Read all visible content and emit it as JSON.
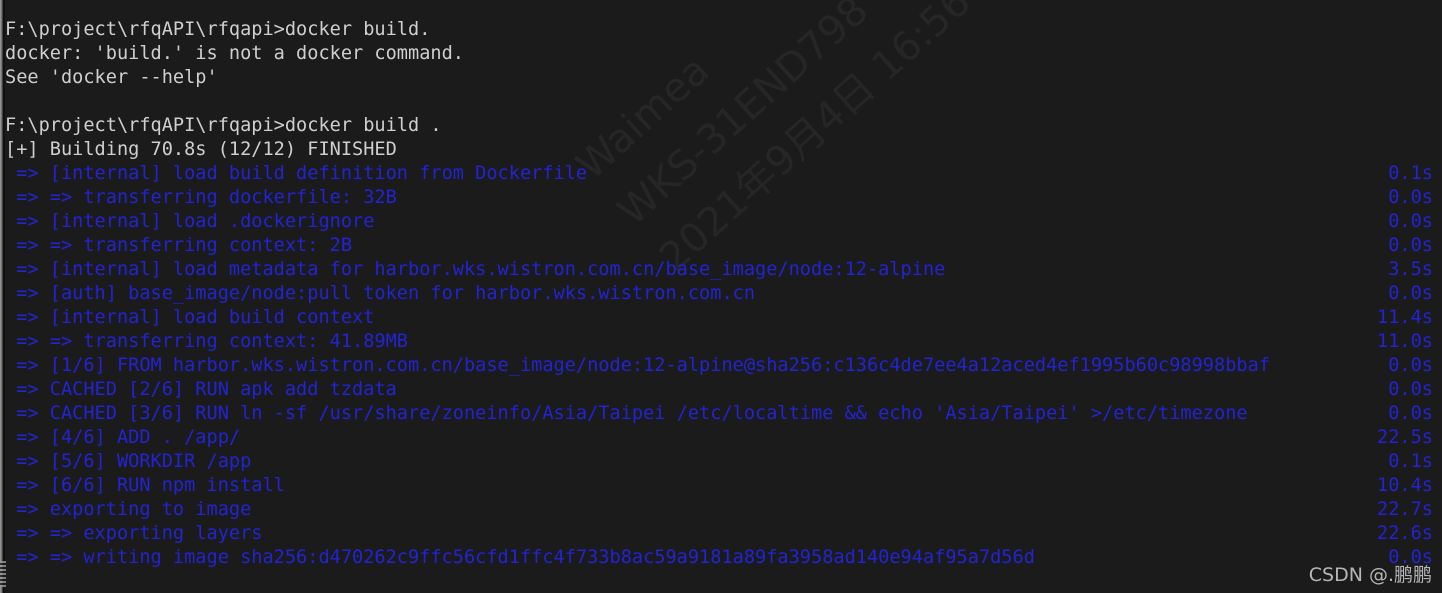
{
  "terminal": {
    "background_color": "#1b1b1b",
    "text_color": "#cfcfcf",
    "build_text_color": "#2323d4",
    "lines": [
      {
        "text": "F:\\project\\rfqAPI\\rfqapi>docker build.",
        "color": "light",
        "time": ""
      },
      {
        "text": "docker: 'build.' is not a docker command.",
        "color": "light",
        "time": ""
      },
      {
        "text": "See 'docker --help'",
        "color": "light",
        "time": ""
      },
      {
        "text": "",
        "color": "light",
        "time": ""
      },
      {
        "text": "F:\\project\\rfqAPI\\rfqapi>docker build .",
        "color": "light",
        "time": ""
      },
      {
        "text": "[+] Building 70.8s (12/12) FINISHED",
        "color": "light",
        "time": ""
      },
      {
        "text": " => [internal] load build definition from Dockerfile",
        "color": "blue",
        "time": "0.1s"
      },
      {
        "text": " => => transferring dockerfile: 32B",
        "color": "blue",
        "time": "0.0s"
      },
      {
        "text": " => [internal] load .dockerignore",
        "color": "blue",
        "time": "0.0s"
      },
      {
        "text": " => => transferring context: 2B",
        "color": "blue",
        "time": "0.0s"
      },
      {
        "text": " => [internal] load metadata for harbor.wks.wistron.com.cn/base_image/node:12-alpine",
        "color": "blue",
        "time": "3.5s"
      },
      {
        "text": " => [auth] base_image/node:pull token for harbor.wks.wistron.com.cn",
        "color": "blue",
        "time": "0.0s"
      },
      {
        "text": " => [internal] load build context",
        "color": "blue",
        "time": "11.4s"
      },
      {
        "text": " => => transferring context: 41.89MB",
        "color": "blue",
        "time": "11.0s"
      },
      {
        "text": " => [1/6] FROM harbor.wks.wistron.com.cn/base_image/node:12-alpine@sha256:c136c4de7ee4a12aced4ef1995b60c98998bbaf",
        "color": "blue",
        "time": "0.0s"
      },
      {
        "text": " => CACHED [2/6] RUN apk add tzdata",
        "color": "blue",
        "time": "0.0s"
      },
      {
        "text": " => CACHED [3/6] RUN ln -sf /usr/share/zoneinfo/Asia/Taipei /etc/localtime && echo 'Asia/Taipei' >/etc/timezone",
        "color": "blue",
        "time": "0.0s"
      },
      {
        "text": " => [4/6] ADD . /app/",
        "color": "blue",
        "time": "22.5s"
      },
      {
        "text": " => [5/6] WORKDIR /app",
        "color": "blue",
        "time": "0.1s"
      },
      {
        "text": " => [6/6] RUN npm install",
        "color": "blue",
        "time": "10.4s"
      },
      {
        "text": " => exporting to image",
        "color": "blue",
        "time": "22.7s"
      },
      {
        "text": " => => exporting layers",
        "color": "blue",
        "time": "22.6s"
      },
      {
        "text": " => => writing image sha256:d470262c9ffc56cfd1ffc4f733b8ac59a9181a89fa3958ad140e94af95a7d56d",
        "color": "blue",
        "time": "0.0s"
      }
    ]
  },
  "watermark": {
    "lines": [
      "Waimea",
      "WKS-31END798",
      "2021年9月4日 16:56"
    ],
    "color": "#262626"
  },
  "credit": {
    "text": "CSDN @.鹏鹏"
  }
}
